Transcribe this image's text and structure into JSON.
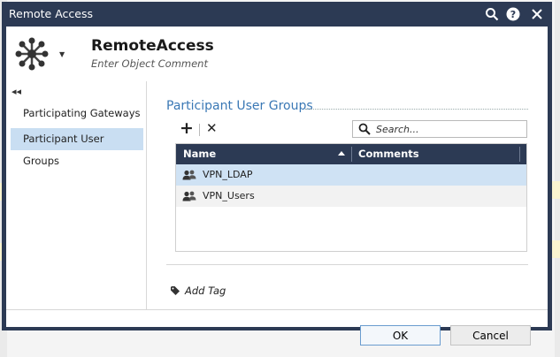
{
  "window": {
    "title": "Remote Access"
  },
  "titlebar_icons": [
    "search-icon",
    "help-icon",
    "close-icon"
  ],
  "object": {
    "name": "RemoteAccess",
    "comment_placeholder": "Enter Object Comment"
  },
  "sidebar": {
    "items": [
      {
        "label": "Participating Gateways",
        "active": false
      },
      {
        "label": "Participant User Groups",
        "active": true
      }
    ]
  },
  "section": {
    "title": "Participant User Groups"
  },
  "search": {
    "placeholder": "Search..."
  },
  "table": {
    "columns": [
      "Name",
      "Comments"
    ],
    "rows": [
      {
        "name": "VPN_LDAP",
        "comments": "",
        "selected": true
      },
      {
        "name": "VPN_Users",
        "comments": "",
        "selected": false
      }
    ]
  },
  "add_tag_label": "Add Tag",
  "buttons": {
    "ok": "OK",
    "cancel": "Cancel"
  },
  "colors": {
    "titlebar": "#2c3a54",
    "accent": "#3a78b5",
    "selection": "#c9def2"
  }
}
